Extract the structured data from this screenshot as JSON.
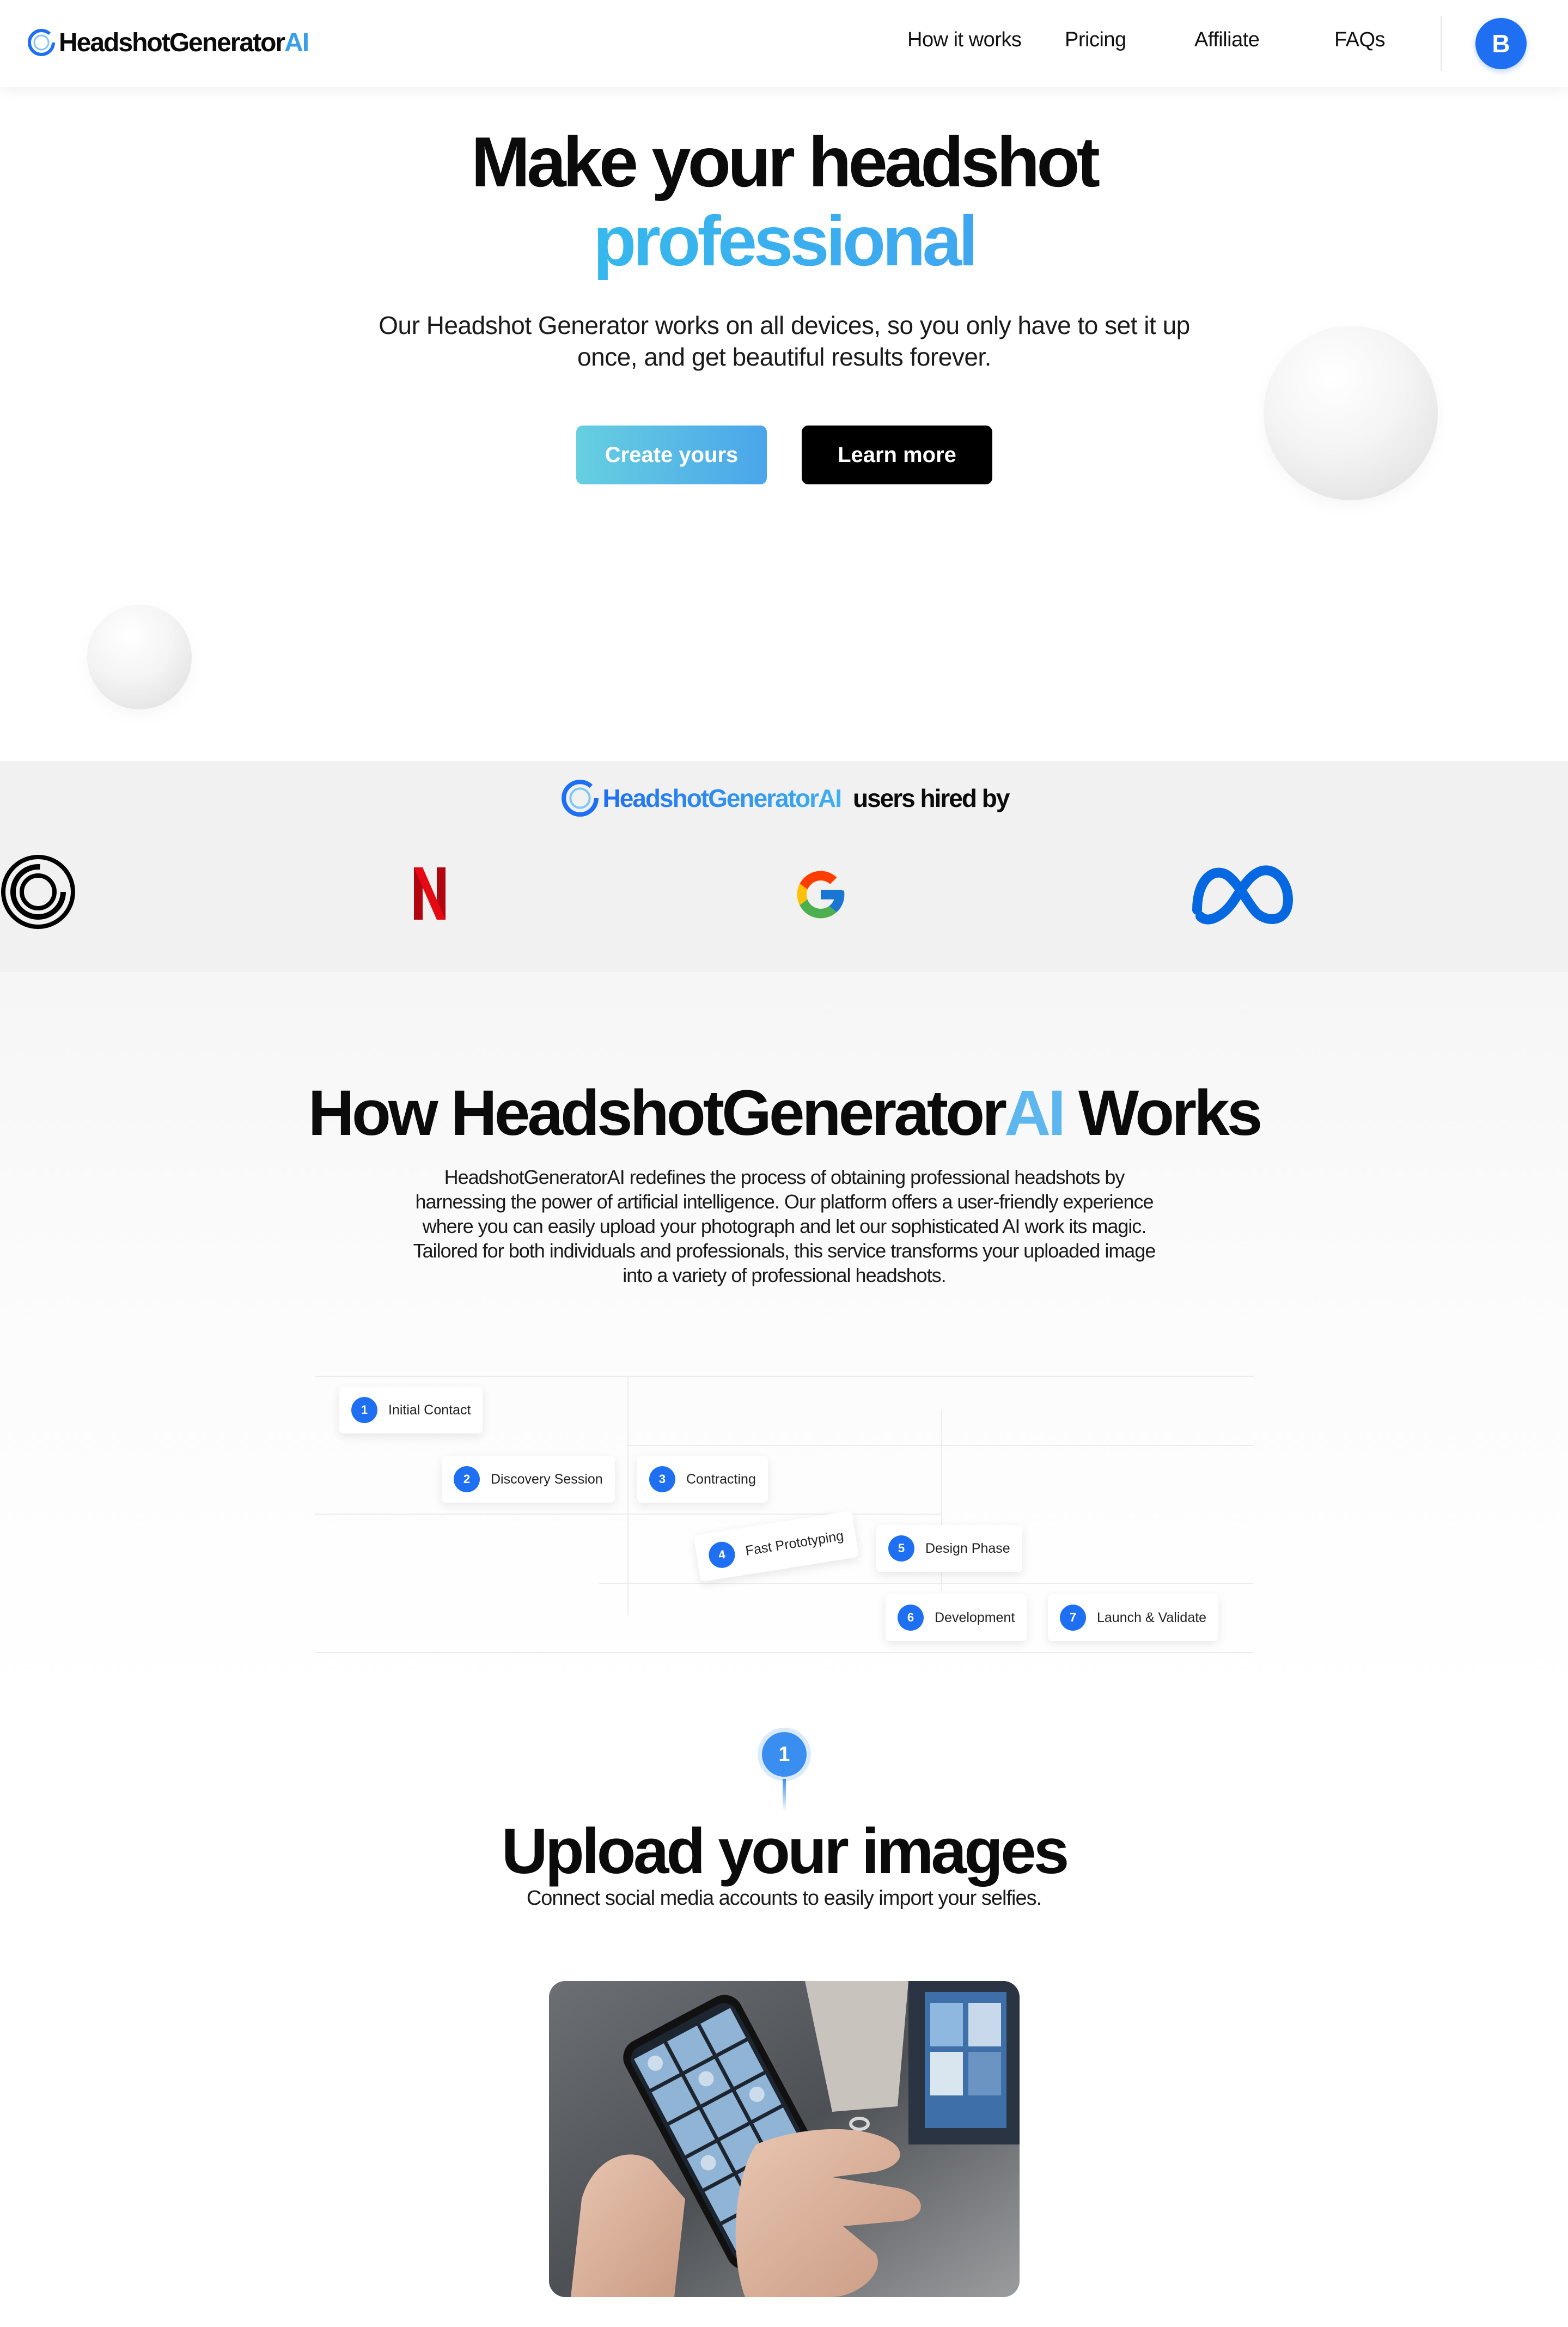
{
  "nav": {
    "logo": {
      "main": "HeadshotGenerator",
      "accent": "AI"
    },
    "links": [
      "How it works",
      "Pricing",
      "Affiliate",
      "FAQs"
    ],
    "avatar_initial": "B"
  },
  "hero": {
    "title_line1": "Make your headshot",
    "title_line2": "professional",
    "subtitle": "Our Headshot Generator works on all devices, so you only have to set it up once, and get beautiful results forever.",
    "primary_button": "Create yours",
    "secondary_button": "Learn more"
  },
  "hired_by": {
    "logo_text": "HeadshotGeneratorAI",
    "text": "users hired by",
    "companies": [
      "circle-logo",
      "netflix-logo",
      "google-logo",
      "meta-logo"
    ]
  },
  "how_it_works": {
    "title_main": "How HeadshotGenerator",
    "title_accent": "AI",
    "title_end": "Works",
    "description": "HeadshotGeneratorAI redefines the process of obtaining professional headshots by harnessing the power of artificial intelligence. Our platform offers a user-friendly experience where you can easily upload your photograph and let our sophisticated AI work its magic. Tailored for both individuals and professionals, this service transforms your uploaded image into a variety of professional headshots.",
    "steps": [
      {
        "num": "1",
        "label": "Initial Contact"
      },
      {
        "num": "2",
        "label": "Discovery Session"
      },
      {
        "num": "3",
        "label": "Contracting"
      },
      {
        "num": "4",
        "label": "Fast Prototyping"
      },
      {
        "num": "5",
        "label": "Design Phase"
      },
      {
        "num": "6",
        "label": "Development"
      },
      {
        "num": "7",
        "label": "Launch & Validate"
      }
    ]
  },
  "step_one": {
    "number": "1",
    "title": "Upload your images",
    "subtitle": "Connect social media accounts to easily import your selfies."
  },
  "colors": {
    "accent_blue": "#1f6ff2",
    "gradient_cyan": "#26d4e6",
    "ai_light_blue": "#5db7ee",
    "netflix_red": "#e50914",
    "meta_blue": "#0668e1"
  }
}
